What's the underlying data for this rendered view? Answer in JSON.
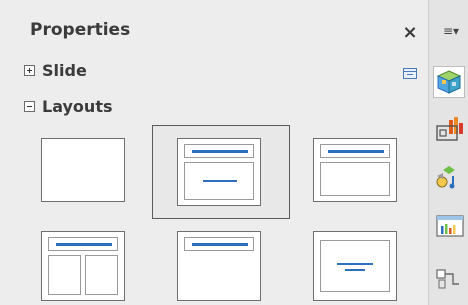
{
  "panel": {
    "title": "Properties",
    "close_glyph": "×",
    "sections": [
      {
        "label": "Slide",
        "expanded": false
      },
      {
        "label": "Layouts",
        "expanded": true
      }
    ],
    "layouts": [
      {
        "name": "Blank Slide",
        "selected": false
      },
      {
        "name": "Title, Content",
        "selected": true
      },
      {
        "name": "Title and 2 Content",
        "selected": false
      },
      {
        "name": "Title, 2 Content",
        "selected": false
      },
      {
        "name": "Title Only",
        "selected": false
      },
      {
        "name": "Centered Text",
        "selected": false
      }
    ]
  },
  "sidebar": {
    "menu_glyph": "≡▾",
    "tabs": [
      "properties-icon",
      "styles-icon",
      "gallery-icon",
      "animation-icon",
      "navigator-icon"
    ]
  },
  "colors": {
    "accent": "#2c6fbd",
    "panel_bg": "#ededed"
  }
}
